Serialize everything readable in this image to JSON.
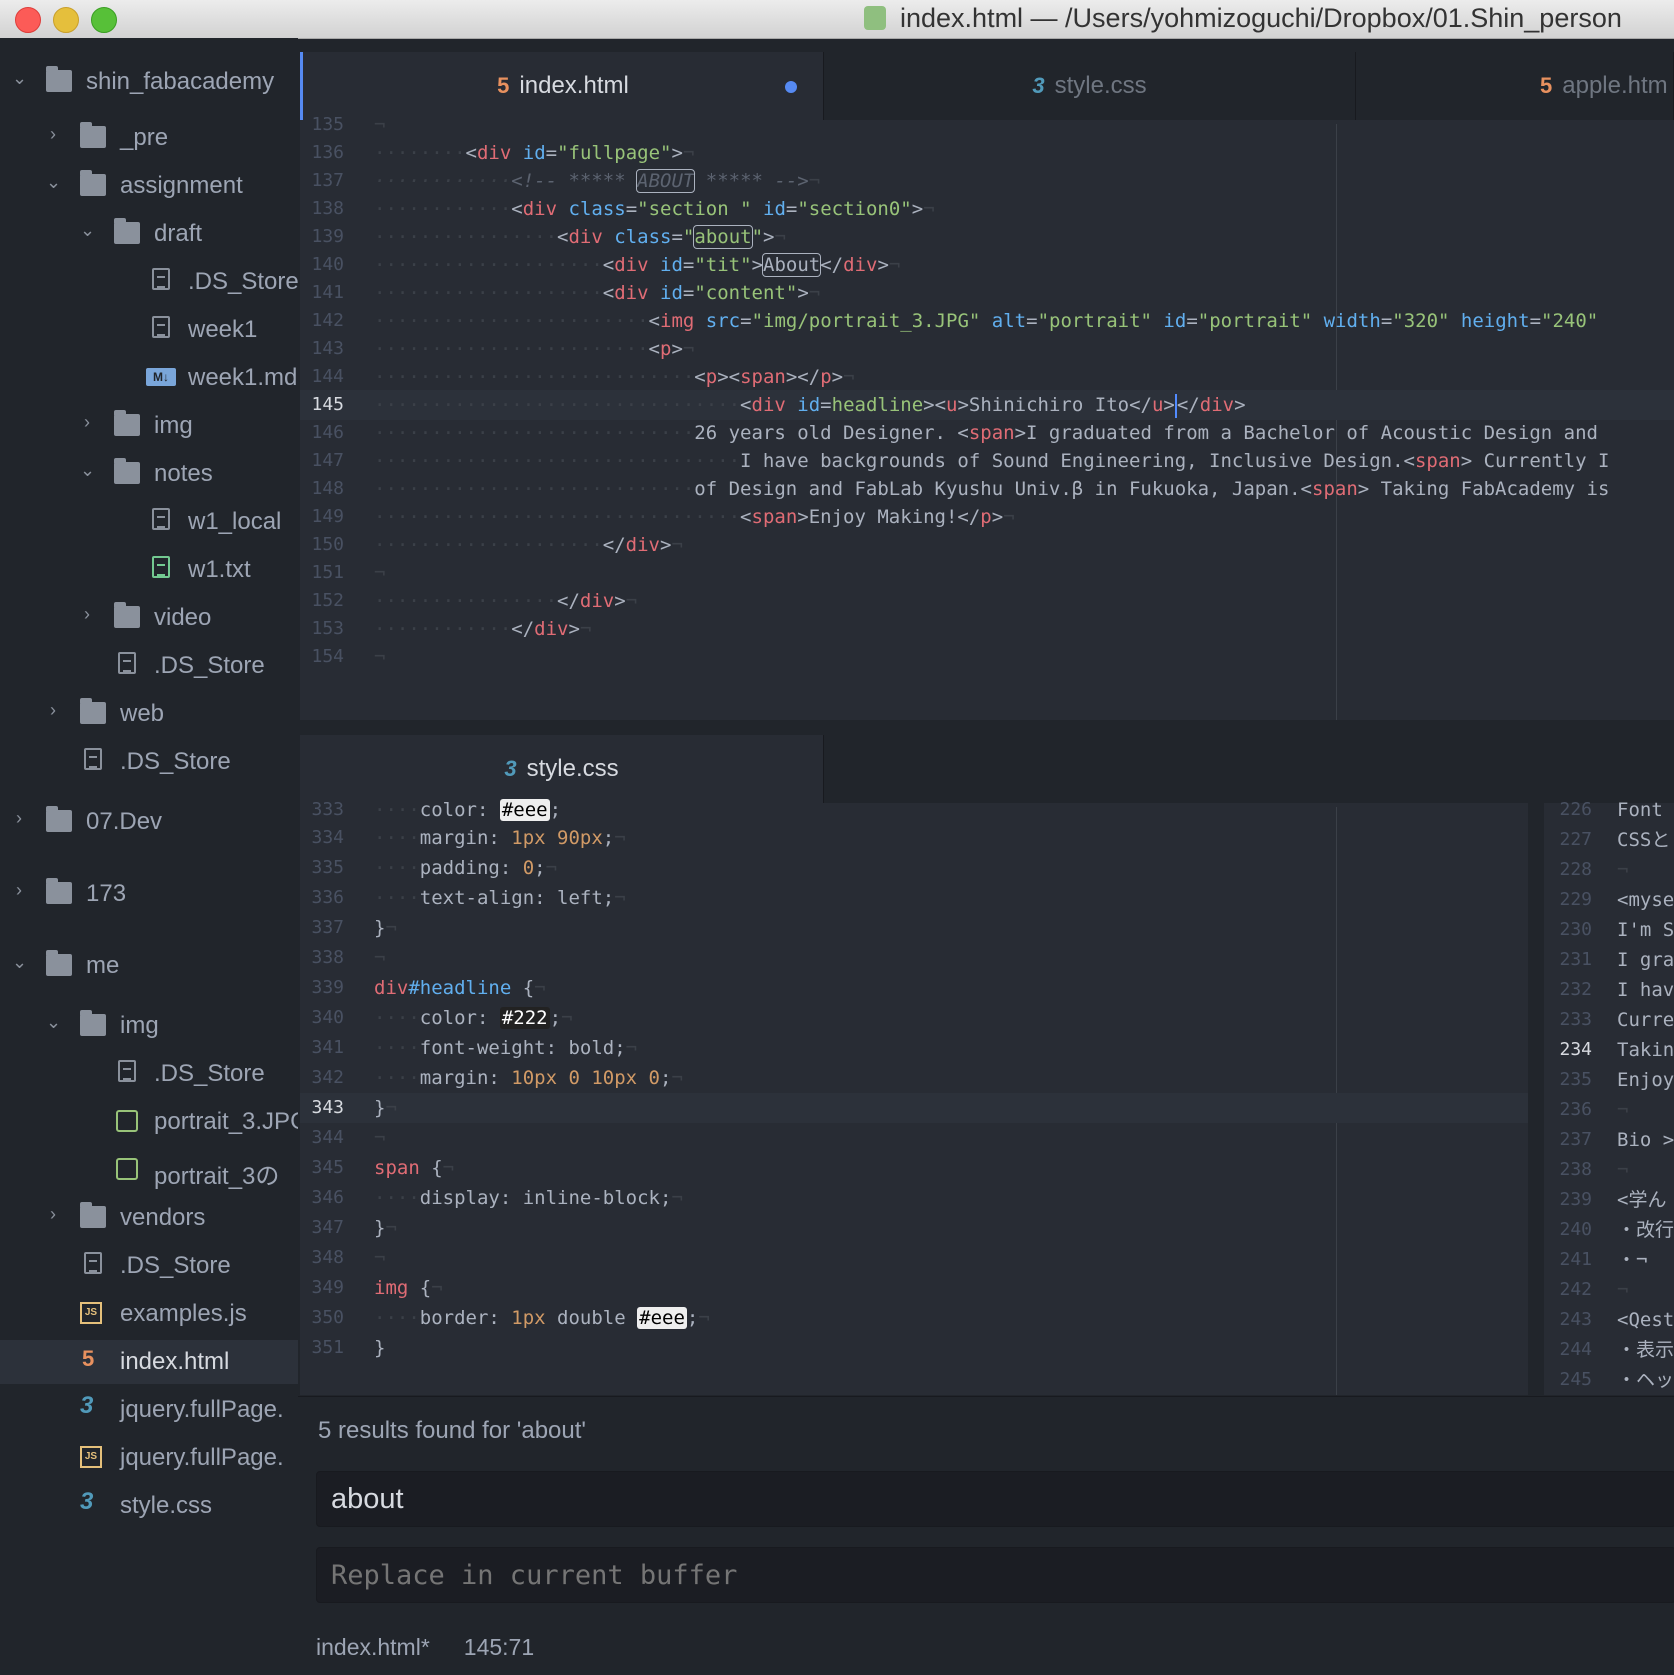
{
  "window": {
    "title": "index.html — /Users/yohmizoguchi/Dropbox/01.Shin_person"
  },
  "tree": {
    "items": [
      {
        "label": "shin_fabacademy"
      },
      {
        "label": "_pre"
      },
      {
        "label": "assignment"
      },
      {
        "label": "draft"
      },
      {
        "label": ".DS_Store"
      },
      {
        "label": "week1"
      },
      {
        "label": "week1.md"
      },
      {
        "label": "img"
      },
      {
        "label": "notes"
      },
      {
        "label": "w1_local"
      },
      {
        "label": "w1.txt"
      },
      {
        "label": "video"
      },
      {
        "label": ".DS_Store"
      },
      {
        "label": "web"
      },
      {
        "label": ".DS_Store"
      },
      {
        "label": "07.Dev"
      },
      {
        "label": "173"
      },
      {
        "label": "me"
      },
      {
        "label": "img"
      },
      {
        "label": ".DS_Store"
      },
      {
        "label": "portrait_3.JPG"
      },
      {
        "label": "portrait_3の"
      },
      {
        "label": "vendors"
      },
      {
        "label": ".DS_Store"
      },
      {
        "label": "examples.js"
      },
      {
        "label": "index.html"
      },
      {
        "label": "jquery.fullPage."
      },
      {
        "label": "jquery.fullPage."
      },
      {
        "label": "style.css"
      }
    ]
  },
  "top_pane": {
    "tabs": [
      {
        "label": "index.html",
        "modified": true
      },
      {
        "label": "style.css"
      },
      {
        "label": "apple.htm"
      }
    ],
    "line_numbers": [
      "135",
      "136",
      "137",
      "138",
      "139",
      "140",
      "141",
      "142",
      "143",
      "144",
      "145",
      "146",
      "147",
      "148",
      "149",
      "150",
      "151",
      "152",
      "153",
      "154"
    ],
    "current_line": "145"
  },
  "bottom_pane": {
    "tab": "style.css",
    "line_numbers": [
      "333",
      "334",
      "335",
      "336",
      "337",
      "338",
      "339",
      "340",
      "341",
      "342",
      "343",
      "344",
      "345",
      "346",
      "347",
      "348",
      "349",
      "350",
      "351"
    ],
    "current_line": "343"
  },
  "right_pane": {
    "line_numbers": [
      "226",
      "227",
      "228",
      "229",
      "230",
      "231",
      "232",
      "233",
      "234",
      "235",
      "236",
      "237",
      "238",
      "239",
      "240",
      "241",
      "242",
      "243",
      "244",
      "245"
    ],
    "lines": [
      "Font ",
      "CSSと",
      "¬",
      "<myse",
      "I'm S",
      "I gra",
      "I hav",
      "Curre",
      "Takin",
      "Enjoy",
      "¬",
      "Bio >",
      "¬",
      "<学ん",
      "・改行",
      "・¬",
      "¬",
      "<Qest",
      "・表示",
      "・ヘッ"
    ]
  },
  "find": {
    "message": "5 results found for 'about'",
    "query": "about",
    "replace_placeholder": "Replace in current buffer"
  },
  "status": {
    "file": "index.html*",
    "position": "145:71"
  },
  "colors": {
    "accent": "#568af2",
    "tag": "#e06c75",
    "attr": "#61afef",
    "string": "#98c379",
    "number": "#d19a66"
  }
}
